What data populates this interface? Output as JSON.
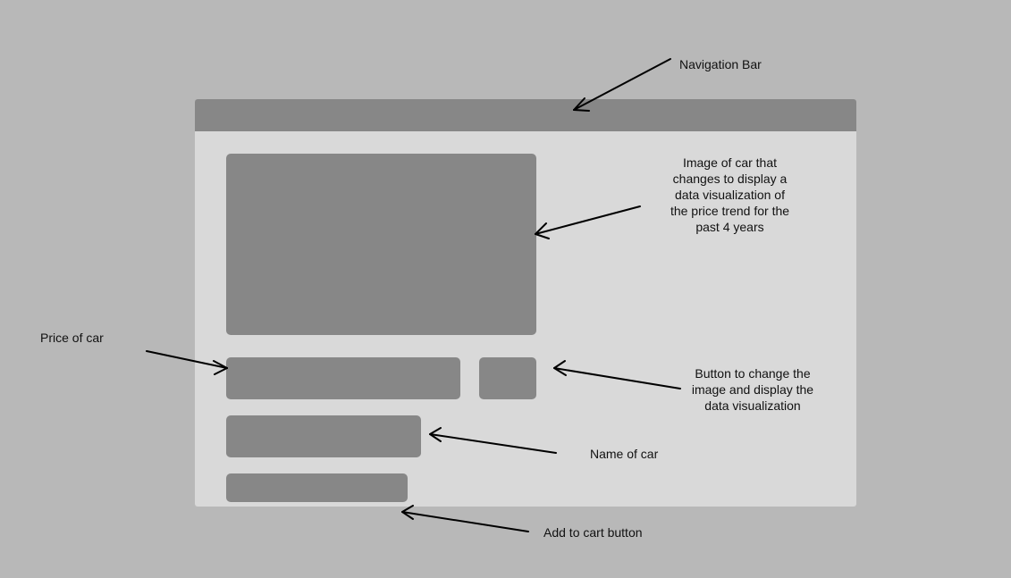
{
  "annotations": {
    "navigation_bar": "Navigation Bar",
    "car_image": [
      "Image of car that",
      "changes to display a",
      "data visualization of",
      "the price trend for the",
      "past 4 years"
    ],
    "price": "Price of car",
    "toggle_button": [
      "Button to change the",
      "image and display the",
      "data visualization"
    ],
    "name": "Name of car",
    "add_to_cart": "Add to cart button"
  },
  "colors": {
    "background": "#b8b8b8",
    "frame": "#d9d9d9",
    "placeholder": "#878787",
    "arrow": "#000000"
  }
}
